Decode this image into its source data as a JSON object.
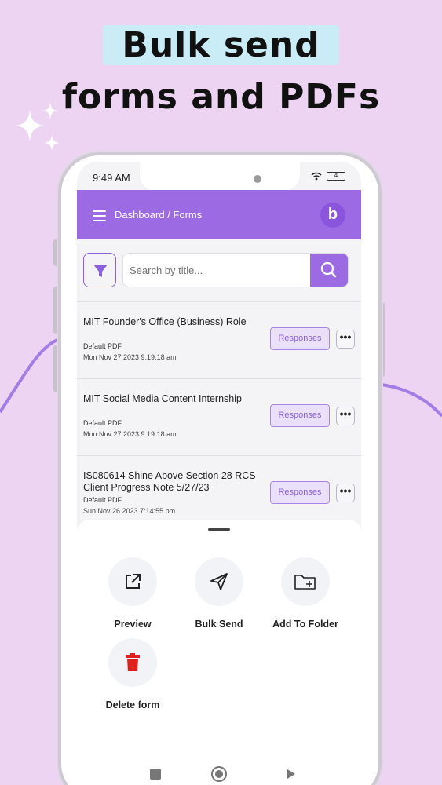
{
  "promo": {
    "headline_line1": "Bulk send",
    "headline_line2": "forms and PDFs"
  },
  "status_bar": {
    "time": "9:49 AM",
    "battery": "4"
  },
  "app_bar": {
    "breadcrumb": "Dashboard / Forms",
    "logo_letter": "b"
  },
  "search": {
    "placeholder": "Search by title..."
  },
  "forms": [
    {
      "title": "MIT Founder's Office (Business) Role",
      "type": "Default PDF",
      "date": "Mon Nov 27 2023  9:19:18 am",
      "responses_label": "Responses",
      "more_label": "•••"
    },
    {
      "title": "MIT Social Media Content Internship",
      "type": "Default PDF",
      "date": "Mon Nov 27 2023  9:19:18 am",
      "responses_label": "Responses",
      "more_label": "•••"
    },
    {
      "title": "IS080614 Shine Above Section 28 RCS Client Progress Note 5/27/23",
      "type": "Default PDF",
      "date": "Sun Nov 26 2023  7:14:55 pm",
      "responses_label": "Responses",
      "more_label": "•••"
    }
  ],
  "action_sheet": {
    "preview": "Preview",
    "bulk_send": "Bulk Send",
    "add_to_folder": "Add To Folder",
    "delete_form": "Delete form"
  },
  "colors": {
    "accent": "#9c6be3",
    "background": "#ecd4f2",
    "delete": "#e0201c"
  },
  "icons": {
    "filter": "filter-icon",
    "search": "search-icon",
    "menu": "hamburger-icon",
    "preview": "external-link-icon",
    "bulk_send": "send-icon",
    "add_to_folder": "folder-plus-icon",
    "delete": "trash-icon"
  }
}
